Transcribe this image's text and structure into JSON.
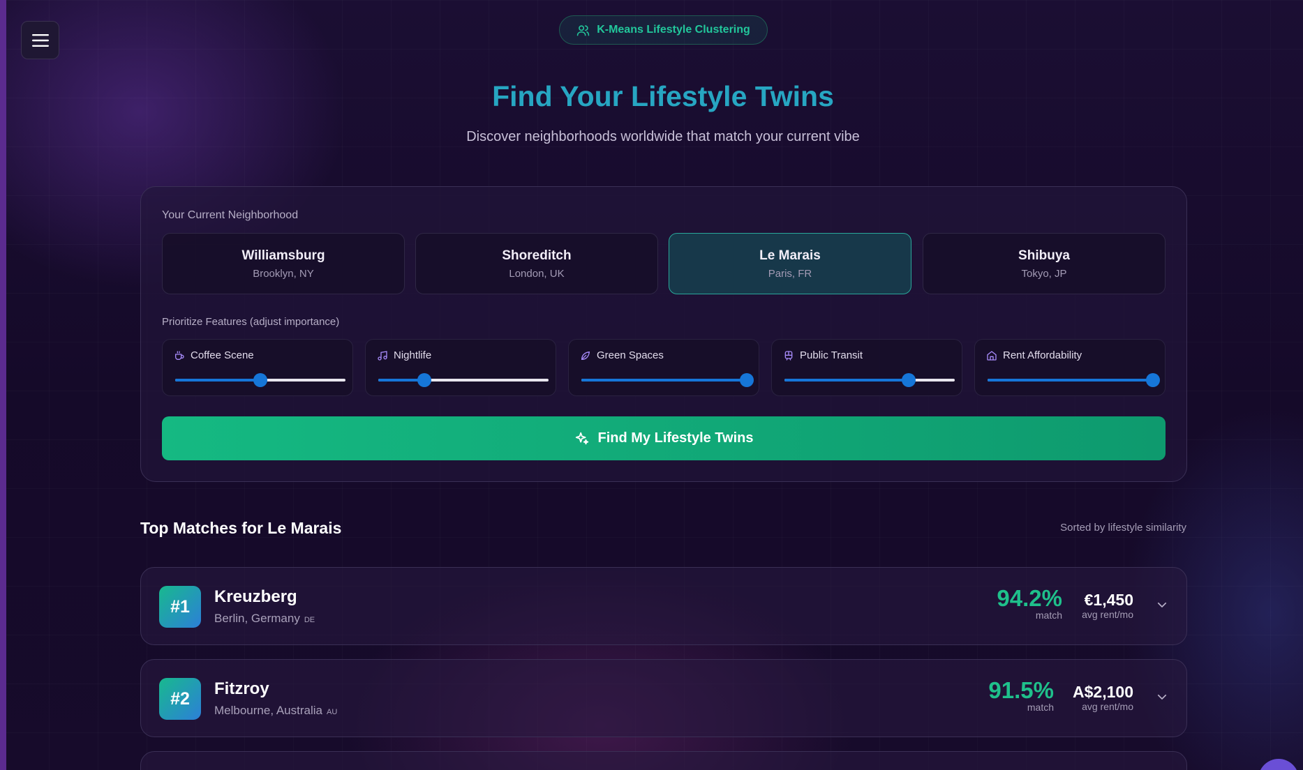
{
  "header": {
    "badge_label": "K-Means Lifestyle Clustering",
    "title": "Find Your Lifestyle Twins",
    "subtitle": "Discover neighborhoods worldwide that match your current vibe"
  },
  "selector": {
    "label": "Your Current Neighborhood",
    "neighborhoods": [
      {
        "name": "Williamsburg",
        "location": "Brooklyn, NY",
        "selected": false
      },
      {
        "name": "Shoreditch",
        "location": "London, UK",
        "selected": false
      },
      {
        "name": "Le Marais",
        "location": "Paris, FR",
        "selected": true
      },
      {
        "name": "Shibuya",
        "location": "Tokyo, JP",
        "selected": false
      }
    ]
  },
  "features": {
    "label": "Prioritize Features (adjust importance)",
    "items": [
      {
        "label": "Coffee Scene",
        "icon": "coffee-icon",
        "value": 0.5
      },
      {
        "label": "Nightlife",
        "icon": "music-icon",
        "value": 0.27
      },
      {
        "label": "Green Spaces",
        "icon": "leaf-icon",
        "value": 0.97
      },
      {
        "label": "Public Transit",
        "icon": "train-icon",
        "value": 0.73
      },
      {
        "label": "Rent Affordability",
        "icon": "home-icon",
        "value": 0.97
      }
    ]
  },
  "action": {
    "find_label": "Find My Lifestyle Twins"
  },
  "results": {
    "title": "Top Matches for Le Marais",
    "sort_label": "Sorted by lifestyle similarity",
    "matches": [
      {
        "rank": "#1",
        "name": "Kreuzberg",
        "location": "Berlin, Germany",
        "country_code": "DE",
        "match": "94.2%",
        "match_label": "match",
        "rent": "€1,450",
        "rent_label": "avg rent/mo"
      },
      {
        "rank": "#2",
        "name": "Fitzroy",
        "location": "Melbourne, Australia",
        "country_code": "AU",
        "match": "91.5%",
        "match_label": "match",
        "rent": "A$2,100",
        "rent_label": "avg rent/mo"
      }
    ]
  },
  "colors": {
    "accent_green": "#1fc08b",
    "title_teal": "#27a6c2",
    "slider_blue": "#1676d8"
  }
}
